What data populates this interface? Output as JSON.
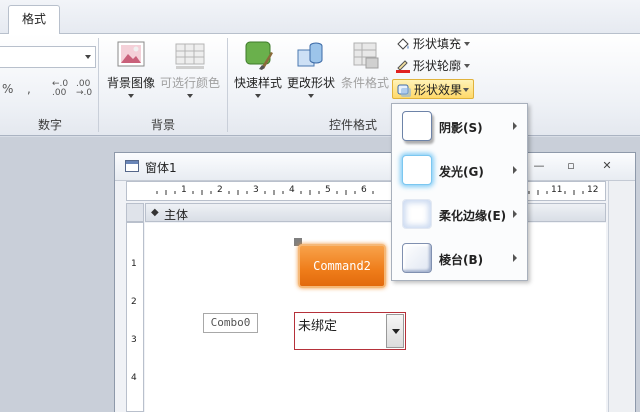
{
  "ribbon": {
    "active_tab": "格式",
    "groups": {
      "number": {
        "label": "数字",
        "percent": "%",
        "comma": ",",
        "increase_decimals": "←.0\n.00",
        "decrease_decimals": ".00\n→.0"
      },
      "background": {
        "label": "背景",
        "background_image": "背景图像",
        "alternate_row_color": "可选行颜色"
      },
      "control_format": {
        "label": "控件格式",
        "quick_styles": "快速样式",
        "change_shape": "更改形状",
        "conditional_formatting": "条件格式",
        "shape_fill": "形状填充",
        "shape_outline": "形状轮廓",
        "shape_effects": "形状效果"
      }
    },
    "colors": {
      "outline_red": "#e02020",
      "highlight": "#ffd96a"
    }
  },
  "form_window": {
    "title": "窗体1",
    "section": "主体",
    "ruler_marks": [
      "1",
      "2",
      "3",
      "4",
      "5",
      "6",
      "11",
      "12"
    ],
    "vruler_marks": [
      "1",
      "2",
      "3",
      "4"
    ],
    "command_button": "Command2",
    "combo_label": "Combo0",
    "combo_value": "未绑定",
    "accent": "#ef7d1a"
  },
  "shape_effects_menu": {
    "items": [
      {
        "label": "阴影(S)",
        "icon": "shadow-preview"
      },
      {
        "label": "发光(G)",
        "icon": "glow-preview"
      },
      {
        "label": "柔化边缘(E)",
        "icon": "soft-edges-preview"
      },
      {
        "label": "棱台(B)",
        "icon": "bevel-preview"
      }
    ]
  }
}
